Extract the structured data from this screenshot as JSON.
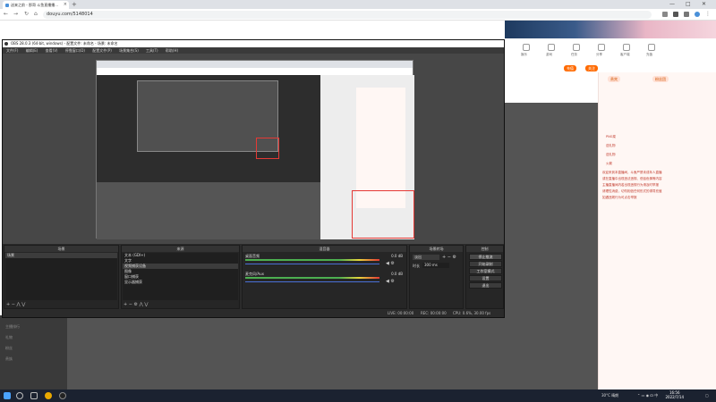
{
  "browser": {
    "tab_title": "送来之前 - 那哥 斗鱼直播播... ",
    "new_tab": "+",
    "url": "douyu.com/5148014",
    "window_controls": [
      "—",
      "□",
      "✕"
    ]
  },
  "obs": {
    "title": "OBS 28.0.3 (64-bit, windows) - 配置文件: 未命名 - 场景: 未命名",
    "menu": [
      "文件(F)",
      "编辑(E)",
      "查看(V)",
      "停靠窗口(D)",
      "配置文件(P)",
      "场景集合(S)",
      "工具(T)",
      "帮助(H)"
    ],
    "docks": {
      "scenes": {
        "header": "场景",
        "items": [
          "场景"
        ]
      },
      "sources": {
        "header": "来源",
        "items": [
          "文本 (GDI+)",
          "文字",
          "视频捕获设备",
          "图像",
          "窗口捕获",
          "显示器捕获"
        ]
      },
      "mixer": {
        "header": "混音器",
        "tracks": [
          {
            "name": "桌面音频",
            "db": "0.0 dB"
          },
          {
            "name": "麦克风/Aux",
            "db": "0.0 dB"
          }
        ]
      },
      "transitions": {
        "header": "场景转场",
        "mode": "淡出",
        "duration_label": "时长",
        "duration": "300 ms"
      },
      "controls": {
        "header": "控制",
        "buttons": [
          "停止推流",
          "开始录制",
          "工作室模式",
          "设置",
          "退出"
        ]
      }
    },
    "status": {
      "live": "LIVE: 00:00:00",
      "rec": "REC: 00:00:00",
      "cpu": "CPU: 0.6%, 30.00 fps"
    }
  },
  "stream_page": {
    "left_menu": [
      "主播排行",
      "礼物",
      "粉丝",
      "贵族"
    ],
    "toolbar_icons": [
      "娱乐",
      "游戏",
      "任务",
      "分享",
      "客户端",
      "充值"
    ],
    "buttons": {
      "follow": "关注",
      "recharge": "充值"
    },
    "panel_tabs": [
      "贵宾",
      "粉丝团"
    ],
    "chat": [
      "欢迎来到本直播间，斗鱼严禁未成年人直播",
      "或在直播中出现违法违规、低俗色情等内容",
      "主播直播间内若出现违规行为请及时举报",
      "请理性消费，切勿相信任何形式的诱导充值",
      "如遇违规行为可点击举报"
    ],
    "chat_users": [
      "PNG菜",
      "送礼物",
      "送礼物",
      "火箭"
    ]
  },
  "taskbar": {
    "weather": "30°C 晴朗",
    "time": "16:56",
    "date": "2022/7/14"
  },
  "colors": {
    "obs_bg": "#2b2b2b",
    "accent_red": "#e53935",
    "douyu_orange": "#ff6a00"
  }
}
